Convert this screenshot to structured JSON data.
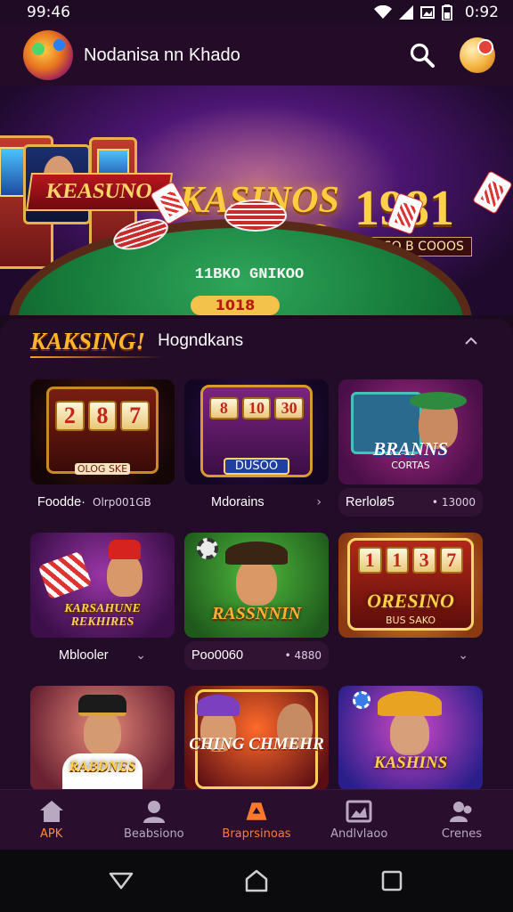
{
  "status_bar": {
    "time_left": "99:46",
    "time_right": "0:92"
  },
  "header": {
    "title": "Nodanisa nn Khado"
  },
  "hero": {
    "badge": "KEASUNO",
    "title": "KASINOS MASIZO",
    "number": "1981",
    "subtitle": "EN SO B COOOS",
    "table_text": "11BKO GNIKOO",
    "table_number": "1018"
  },
  "section": {
    "title": "KAKSING!",
    "subtitle": "Hogndkans"
  },
  "games": [
    {
      "thumb_title": "",
      "thumb_sub": "OLOG SKE",
      "reels": [
        "2",
        "8",
        "7"
      ],
      "name": "Foodde·",
      "value": "Olrp001GB",
      "chevron": ""
    },
    {
      "thumb_title": "",
      "thumb_sub": "DUSOO",
      "reels": [
        "8",
        "10",
        "30"
      ],
      "name": "Mdorains",
      "value": "",
      "chevron": "›"
    },
    {
      "thumb_title": "BRANNS",
      "thumb_sub": "CORTAS",
      "reels": [],
      "name": "Rerlolø5",
      "value": "• 13000",
      "chevron": ""
    },
    {
      "thumb_title": "KARSAHUNE REKHIRES",
      "thumb_sub": "",
      "reels": [],
      "name": "Mblooler",
      "value": "",
      "chevron": "⌄"
    },
    {
      "thumb_title": "RASSNNIN",
      "thumb_sub": "",
      "reels": [],
      "name": "Poo0060",
      "value": "• 4880",
      "chevron": ""
    },
    {
      "thumb_title": "ORESINO",
      "thumb_sub": "BUS SAKO",
      "reels": [
        "1",
        "1",
        "3",
        "7"
      ],
      "name": "",
      "value": "",
      "chevron": "⌄"
    },
    {
      "thumb_title": "RABDNES",
      "thumb_sub": "",
      "reels": [],
      "name": "",
      "value": "",
      "chevron": ""
    },
    {
      "thumb_title": "CHING CHMEHR",
      "thumb_sub": "",
      "reels": [],
      "name": "",
      "value": "",
      "chevron": ""
    },
    {
      "thumb_title": "KASHINS",
      "thumb_sub": "",
      "reels": [],
      "name": "",
      "value": "",
      "chevron": ""
    }
  ],
  "bottom_nav": [
    {
      "label": "APK",
      "icon": "home-icon",
      "active": false
    },
    {
      "label": "Beabsiono",
      "icon": "user-icon",
      "active": false
    },
    {
      "label": "Braprsinoas",
      "icon": "casino-icon",
      "active": true
    },
    {
      "label": "Andlvlaoo",
      "icon": "image-icon",
      "active": false
    },
    {
      "label": "Crenes",
      "icon": "people-icon",
      "active": false
    }
  ],
  "colors": {
    "background": "#1c0a1f",
    "accent": "#ff7a2d",
    "gold": "#ffb62c"
  }
}
